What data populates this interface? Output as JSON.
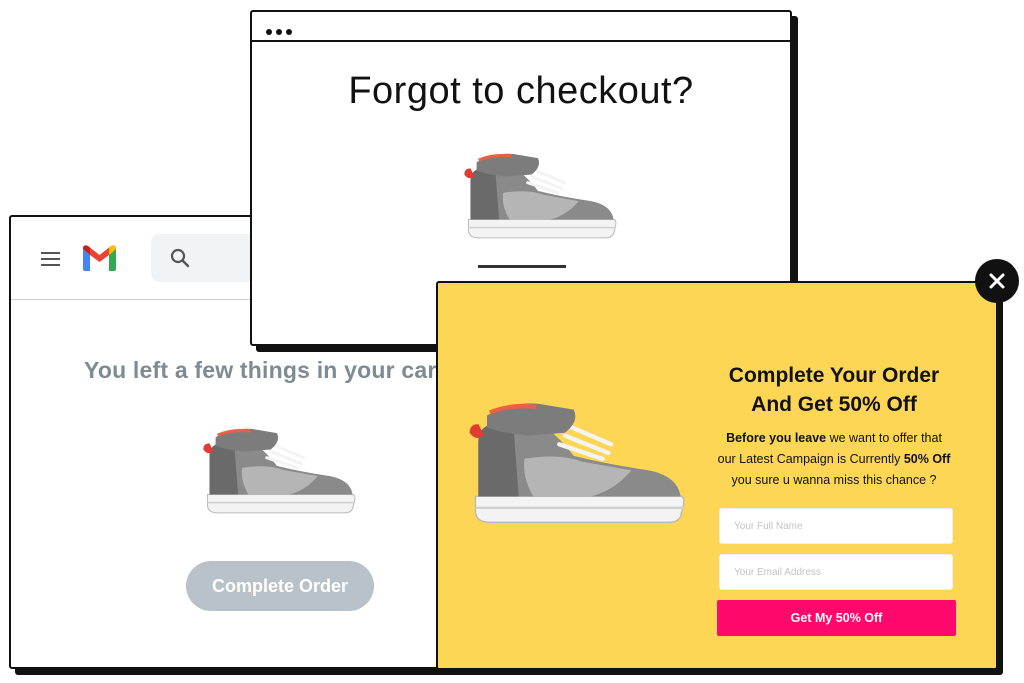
{
  "browser": {
    "title": "Forgot to checkout?"
  },
  "gmail": {
    "body_title": "You left a few things in your car",
    "cta_label": "Complete Order",
    "search_icon": "search-icon",
    "menu_icon": "hamburger-menu-icon",
    "logo": "gmail-logo"
  },
  "popup": {
    "heading_line1": "Complete Your Order",
    "heading_line2": "And Get 50% Off",
    "desc_bold1": "Before you leave",
    "desc_text1": " we want to offer that",
    "desc_text2": "our Latest Campaign is Currently ",
    "desc_bold2": "50% Off",
    "desc_text3": "you sure u wanna miss this chance ?",
    "name_placeholder": "Your Full Name",
    "email_placeholder": "Your Email Address",
    "cta_label": "Get My 50% Off",
    "close_icon": "close-icon"
  },
  "colors": {
    "popup_bg": "#fcd654",
    "popup_cta": "#ff0a6c",
    "gmail_cta": "#b8c2c8",
    "gmail_title": "#7d8b92"
  }
}
